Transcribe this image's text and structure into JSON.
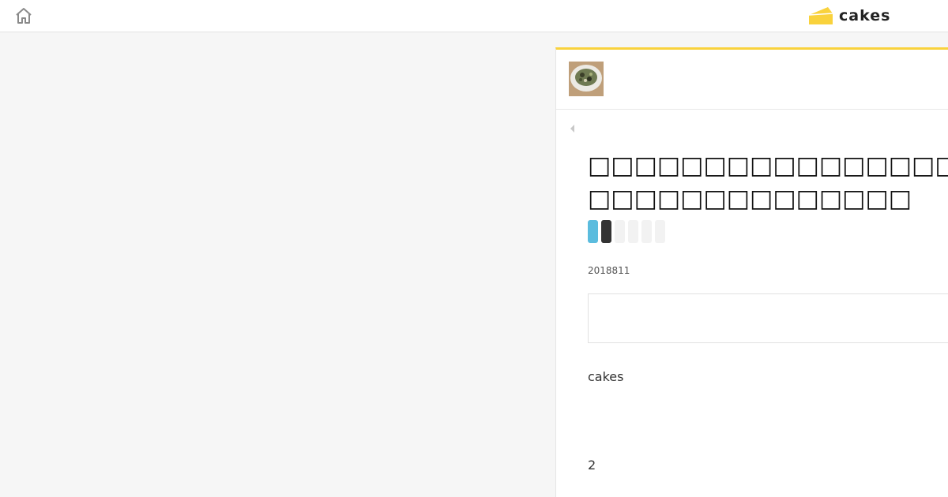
{
  "header": {
    "home_icon": "home-icon",
    "logo_text": "cakes",
    "logo_color": "#f9d23c"
  },
  "article": {
    "title": "□□□□□□□□□□□□□□□□□□□□□□□□□□□□□□□□□□",
    "date": "2018811",
    "paragraphs": [
      "cakes",
      "2"
    ]
  },
  "colors": {
    "accent": "#f9d23c",
    "badge_blue": "#5bbcde",
    "badge_dark": "#333333"
  }
}
